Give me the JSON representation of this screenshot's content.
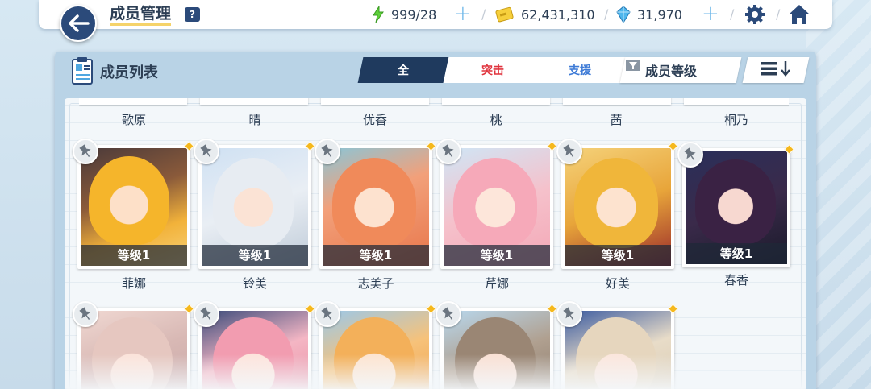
{
  "header": {
    "title": "成员管理",
    "help": "?",
    "stamina": "999/28",
    "credits": "62,431,310",
    "gems": "31,970",
    "plus": "+",
    "separator": "/"
  },
  "panel": {
    "title": "成员列表",
    "tabs": [
      "全",
      "突击",
      "支援"
    ],
    "sort_label": "成员等级"
  },
  "colors": {
    "accent_dark": "#1f3a5e",
    "strike_red": "#e0343e",
    "support_blue": "#3d7ad6",
    "highlight_yellow": "#f5b81d"
  },
  "top_row_names": [
    "歌原",
    "晴",
    "优香",
    "桃",
    "茜",
    "桐乃"
  ],
  "row1": [
    {
      "name": "菲娜",
      "level": "等级1"
    },
    {
      "name": "铃美",
      "level": "等级1"
    },
    {
      "name": "志美子",
      "level": "等级1"
    },
    {
      "name": "芹娜",
      "level": "等级1"
    },
    {
      "name": "好美",
      "level": "等级1"
    },
    {
      "name": "春香",
      "level": "等级1"
    }
  ],
  "row2_count": 5
}
